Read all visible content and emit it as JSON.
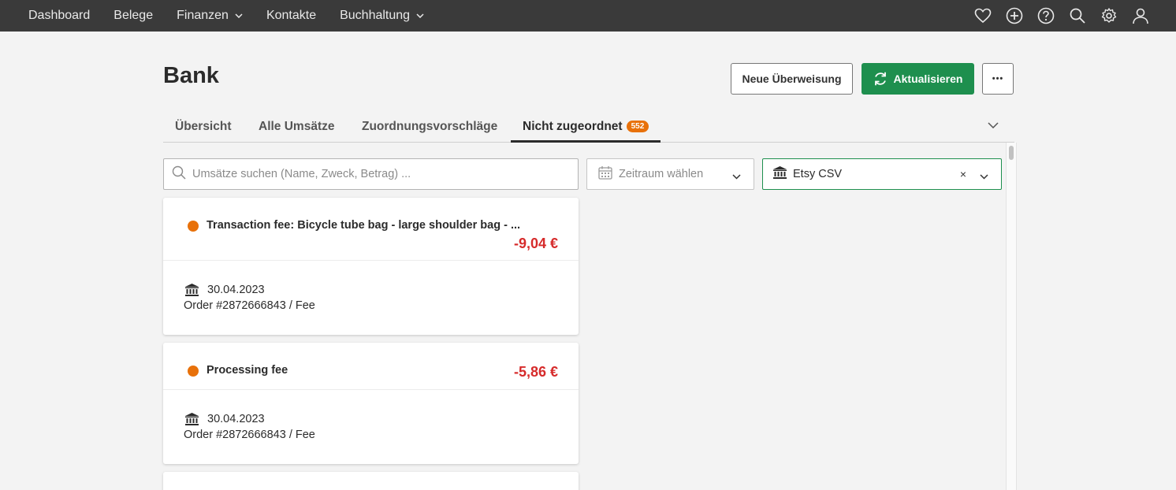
{
  "nav": {
    "items": [
      {
        "label": "Dashboard",
        "dropdown": false
      },
      {
        "label": "Belege",
        "dropdown": false
      },
      {
        "label": "Finanzen",
        "dropdown": true
      },
      {
        "label": "Kontakte",
        "dropdown": false
      },
      {
        "label": "Buchhaltung",
        "dropdown": true
      }
    ],
    "icons": [
      "heart-icon",
      "plus-circle-icon",
      "help-icon",
      "search-icon",
      "gear-icon",
      "user-icon"
    ]
  },
  "header": {
    "title": "Bank",
    "new_transfer_label": "Neue Überweisung",
    "refresh_label": "Aktualisieren",
    "more_label": "•••"
  },
  "tabs": [
    {
      "label": "Übersicht",
      "active": false
    },
    {
      "label": "Alle Umsätze",
      "active": false
    },
    {
      "label": "Zuordnungsvorschläge",
      "active": false
    },
    {
      "label": "Nicht zugeordnet",
      "active": true,
      "badge": "552"
    }
  ],
  "filters": {
    "search_placeholder": "Umsätze suchen (Name, Zweck, Betrag) ...",
    "search_value": "",
    "date_placeholder": "Zeitraum wählen",
    "account_value": "Etsy CSV",
    "account_clear": "×"
  },
  "transactions": [
    {
      "title": "Transaction fee: Bicycle tube bag - large shoulder bag - ...",
      "amount": "-9,04 €",
      "date": "30.04.2023",
      "reference": "Order #2872666843 / Fee",
      "status_color": "#e8710a"
    },
    {
      "title": "Processing fee",
      "amount": "-5,86 €",
      "date": "30.04.2023",
      "reference": "Order #2872666843 / Fee",
      "status_color": "#e8710a"
    }
  ],
  "colors": {
    "accent": "#1e8f4e",
    "negative": "#d62b2b",
    "badge": "#e8710a",
    "topbar": "#3a3a3a"
  }
}
